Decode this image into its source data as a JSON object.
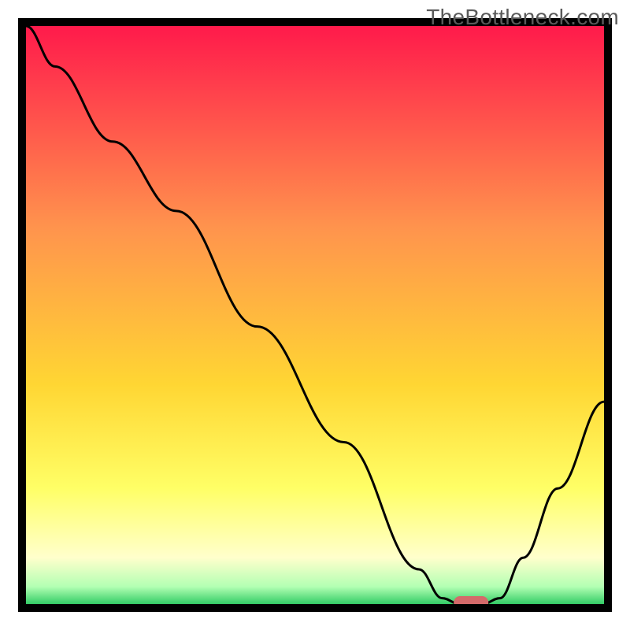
{
  "watermark": "TheBottleneck.com",
  "chart_data": {
    "type": "line",
    "title": "",
    "xlabel": "",
    "ylabel": "",
    "xlim": [
      0,
      100
    ],
    "ylim": [
      0,
      100
    ],
    "grid": false,
    "axes_visible": false,
    "series": [
      {
        "name": "bottleneck-curve",
        "x": [
          0,
          5,
          15,
          26,
          40,
          55,
          68,
          72,
          75,
          79,
          82,
          86,
          92,
          100
        ],
        "y": [
          100,
          93,
          80,
          68,
          48,
          28,
          6,
          1,
          0,
          0,
          1,
          8,
          20,
          35
        ]
      }
    ],
    "marker": {
      "name": "optimal-point",
      "x": 77,
      "y": 0,
      "width": 6,
      "color": "#d46a6a"
    },
    "background_gradient": {
      "top": "#ff1a4b",
      "upper_mid": "#ff944d",
      "mid": "#ffd633",
      "lower_mid": "#ffff66",
      "pale": "#ffffcc",
      "green_light": "#b3ffb3",
      "green": "#33cc66"
    },
    "frame_color": "#000000"
  }
}
